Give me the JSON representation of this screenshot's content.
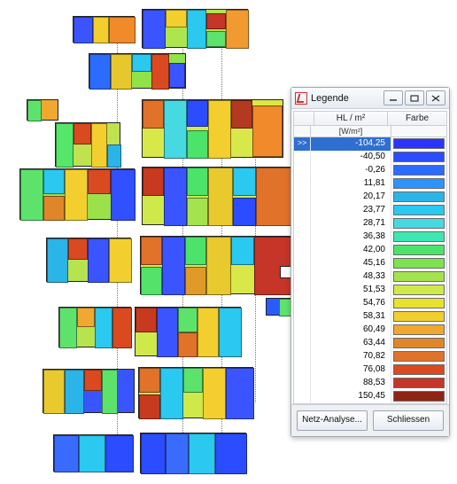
{
  "legend": {
    "title": "Legende",
    "columns": {
      "value": "HL / m²",
      "color": "Farbe"
    },
    "unit": "[W/m²]",
    "selected_marker": ">>",
    "buttons": {
      "analyse": "Netz-Analyse...",
      "close": "Schliessen"
    },
    "entries": [
      {
        "value": "-104,25",
        "color": "#2b34ff",
        "selected": true
      },
      {
        "value": "-40,50",
        "color": "#2b4cff"
      },
      {
        "value": "-0,26",
        "color": "#2b6cff"
      },
      {
        "value": "11,81",
        "color": "#2b94ff"
      },
      {
        "value": "20,17",
        "color": "#2bb4e8"
      },
      {
        "value": "23,77",
        "color": "#2bc8ef"
      },
      {
        "value": "28,71",
        "color": "#46d9e2"
      },
      {
        "value": "36,38",
        "color": "#40e6b0"
      },
      {
        "value": "42,00",
        "color": "#4be36a"
      },
      {
        "value": "45,16",
        "color": "#7ae34e"
      },
      {
        "value": "48,33",
        "color": "#a4e34e"
      },
      {
        "value": "51,53",
        "color": "#cfe84a"
      },
      {
        "value": "54,76",
        "color": "#e8e22e"
      },
      {
        "value": "58,31",
        "color": "#f2cf2e"
      },
      {
        "value": "60,49",
        "color": "#f0a830"
      },
      {
        "value": "63,44",
        "color": "#e0862a"
      },
      {
        "value": "70,82",
        "color": "#e0722a"
      },
      {
        "value": "76,08",
        "color": "#d94a20"
      },
      {
        "value": "88,53",
        "color": "#c53528"
      },
      {
        "value": "150,45",
        "color": "#8e2414"
      }
    ]
  },
  "chart_data": {
    "type": "heatmap",
    "title": "HL / m²",
    "unit": "W/m²",
    "color_scale": [
      {
        "value": -104.25,
        "color": "#2b34ff"
      },
      {
        "value": -40.5,
        "color": "#2b4cff"
      },
      {
        "value": -0.26,
        "color": "#2b6cff"
      },
      {
        "value": 11.81,
        "color": "#2b94ff"
      },
      {
        "value": 20.17,
        "color": "#2bb4e8"
      },
      {
        "value": 23.77,
        "color": "#2bc8ef"
      },
      {
        "value": 28.71,
        "color": "#46d9e2"
      },
      {
        "value": 36.38,
        "color": "#40e6b0"
      },
      {
        "value": 42.0,
        "color": "#4be36a"
      },
      {
        "value": 45.16,
        "color": "#7ae34e"
      },
      {
        "value": 48.33,
        "color": "#a4e34e"
      },
      {
        "value": 51.53,
        "color": "#cfe84a"
      },
      {
        "value": 54.76,
        "color": "#e8e22e"
      },
      {
        "value": 58.31,
        "color": "#f2cf2e"
      },
      {
        "value": 60.49,
        "color": "#f0a830"
      },
      {
        "value": 63.44,
        "color": "#e0862a"
      },
      {
        "value": 70.82,
        "color": "#e0722a"
      },
      {
        "value": 76.08,
        "color": "#d94a20"
      },
      {
        "value": 88.53,
        "color": "#c53528"
      },
      {
        "value": 150.45,
        "color": "#8e2414"
      }
    ],
    "note": "Exploded multi-storey building floor plans, rooms colored by specific heating load (HL) in W/m²"
  }
}
